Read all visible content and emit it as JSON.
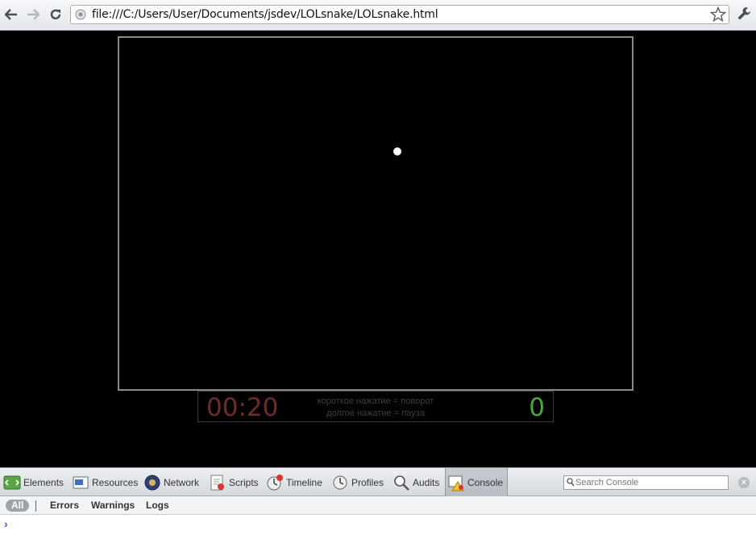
{
  "browser": {
    "url": "file:///C:/Users/User/Documents/jsdev/LOLsnake/LOLsnake.html",
    "icons": [
      "back-icon",
      "forward-icon",
      "reload-icon",
      "page-icon",
      "star-icon",
      "wrench-icon"
    ]
  },
  "game": {
    "timer": "00:20",
    "hint_line1": "короткое нажатие = поворот",
    "hint_line2": "долгое нажатие = пауза",
    "score": "0",
    "colors": {
      "timer": "#6b2e2a",
      "score": "#4aa83a",
      "snake": "#ffffff",
      "background": "#000000"
    }
  },
  "devtools": {
    "tabs": [
      {
        "label": "Elements",
        "icon": "elements-icon"
      },
      {
        "label": "Resources",
        "icon": "resources-icon"
      },
      {
        "label": "Network",
        "icon": "network-icon"
      },
      {
        "label": "Scripts",
        "icon": "scripts-icon"
      },
      {
        "label": "Timeline",
        "icon": "timeline-icon"
      },
      {
        "label": "Profiles",
        "icon": "profiles-icon"
      },
      {
        "label": "Audits",
        "icon": "audits-icon"
      },
      {
        "label": "Console",
        "icon": "console-icon",
        "selected": true
      }
    ],
    "search_placeholder": "Search Console",
    "filters": [
      "All",
      "Errors",
      "Warnings",
      "Logs"
    ],
    "active_filter": "All",
    "prompt": "›"
  }
}
